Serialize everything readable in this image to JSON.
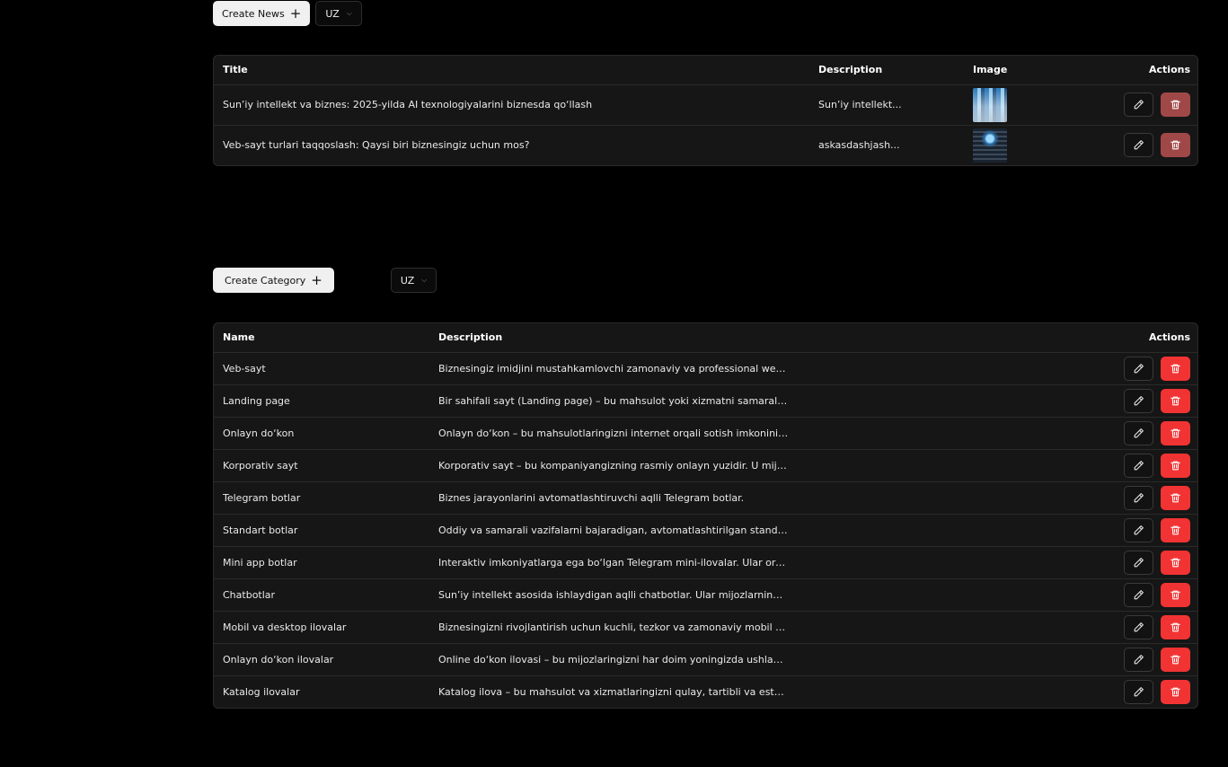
{
  "news_section": {
    "create_label": "Create News",
    "lang": "UZ",
    "columns": {
      "title": "Title",
      "description": "Description",
      "image": "Image",
      "actions": "Actions"
    },
    "rows": [
      {
        "title": "Sun’iy intellekt va biznes: 2025-yilda AI texnologiyalarini biznesda qo‘llash",
        "description": "Sun’iy intellekt...",
        "image": "news-thumbnail-office"
      },
      {
        "title": "Veb-sayt turlari taqqoslash: Qaysi biri biznesingiz uchun mos?",
        "description": "askasdashjash...",
        "image": "news-thumbnail-tech"
      }
    ]
  },
  "category_section": {
    "create_label": "Create Category",
    "lang": "UZ",
    "columns": {
      "name": "Name",
      "description": "Description",
      "actions": "Actions"
    },
    "rows": [
      {
        "name": "Veb-sayt",
        "description": "Biznesingiz imidjini mustahkamlovchi zamonaviy va professional web-saytlar."
      },
      {
        "name": "Landing page",
        "description": "Bir sahifali sayt (Landing page) – bu mahsulot yoki xizmatni samarali targ‘ib qili..."
      },
      {
        "name": "Onlayn do‘kon",
        "description": "Onlayn do‘kon – bu mahsulotlaringizni internet orqali sotish imkonini beruvchi ..."
      },
      {
        "name": "Korporativ sayt",
        "description": "Korporativ sayt – bu kompaniyangizning rasmiy onlayn yuzidir. U mijozlar, inves..."
      },
      {
        "name": "Telegram botlar",
        "description": "Biznes jarayonlarini avtomatlashtiruvchi aqlli Telegram botlar."
      },
      {
        "name": "Standart botlar",
        "description": "Oddiy va samarali vazifalarni bajaradigan, avtomatlashtirilgan standart Telegra..."
      },
      {
        "name": "Mini app botlar",
        "description": "Interaktiv imkoniyatlarga ega bo‘lgan Telegram mini-ilovalar. Ular orqali mijozla..."
      },
      {
        "name": "Chatbotlar",
        "description": "Sun’iy intellekt asosida ishlaydigan aqlli chatbotlar. Ular mijozlarning murakkab ..."
      },
      {
        "name": "Mobil va desktop ilovalar",
        "description": "Biznesingizni rivojlantirish uchun kuchli, tezkor va zamonaviy mobil va desktop ..."
      },
      {
        "name": "Onlayn do‘kon ilovalar",
        "description": "Online do‘kon ilovasi – bu mijozlaringizni har doim yoningizda ushlab turuvchi ..."
      },
      {
        "name": "Katalog ilovalar",
        "description": "Katalog ilova – bu mahsulot va xizmatlaringizni qulay, tartibli va estetik ko‘rinis..."
      }
    ]
  },
  "icons": {
    "edit": "pencil-icon",
    "delete": "trash-icon",
    "add": "plus-icon",
    "dropdown": "chevron-down-icon"
  }
}
